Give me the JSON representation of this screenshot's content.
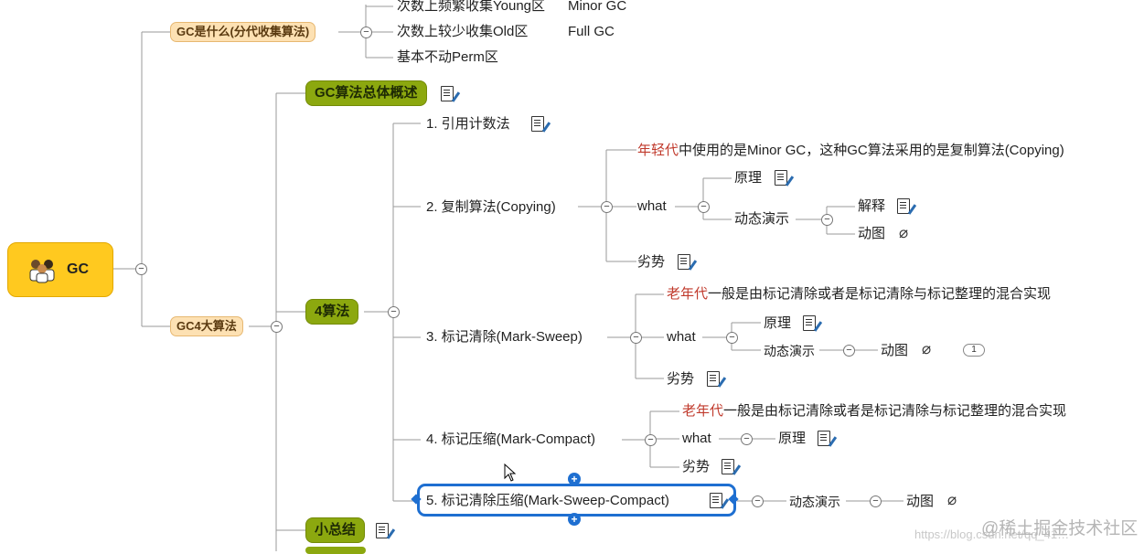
{
  "root": {
    "label": "GC",
    "icon": "people-icon"
  },
  "branch1": {
    "label": "GC是什么(分代收集算法)",
    "items": [
      {
        "label": "次数上频繁收集Young区",
        "extra": "Minor GC"
      },
      {
        "label": "次数上较少收集Old区",
        "extra": "Full GC"
      },
      {
        "label": "基本不动Perm区"
      }
    ]
  },
  "branch2": {
    "label": "GC4大算法",
    "overview": "GC算法总体概述",
    "four": "4算法",
    "summary": "小总结",
    "algos": {
      "a1": "1. 引用计数法",
      "a2": {
        "label": "2. 复制算法(Copying)",
        "desc_red": "年轻代",
        "desc_rest": "中使用的是Minor GC，这种GC算法采用的是复制算法(Copying)",
        "what": "what",
        "principle": "原理",
        "demo": "动态演示",
        "explain": "解释",
        "gif": "动图",
        "weakness": "劣势"
      },
      "a3": {
        "label": "3. 标记清除(Mark-Sweep)",
        "desc_red": "老年代",
        "desc_rest": "一般是由标记清除或者是标记清除与标记整理的混合实现",
        "what": "what",
        "principle": "原理",
        "demo": "动态演示",
        "gif": "动图",
        "badge": "1",
        "weakness": "劣势"
      },
      "a4": {
        "label": "4. 标记压缩(Mark-Compact)",
        "desc_red": "老年代",
        "desc_rest": "一般是由标记清除或者是标记清除与标记整理的混合实现",
        "what": "what",
        "principle": "原理",
        "weakness": "劣势"
      },
      "a5": {
        "label": "5. 标记清除压缩(Mark-Sweep-Compact)",
        "demo": "动态演示",
        "gif": "动图"
      }
    }
  },
  "watermark": "@稀土掘金技术社区",
  "url": "https://blog.csdn.net/qq_41…"
}
